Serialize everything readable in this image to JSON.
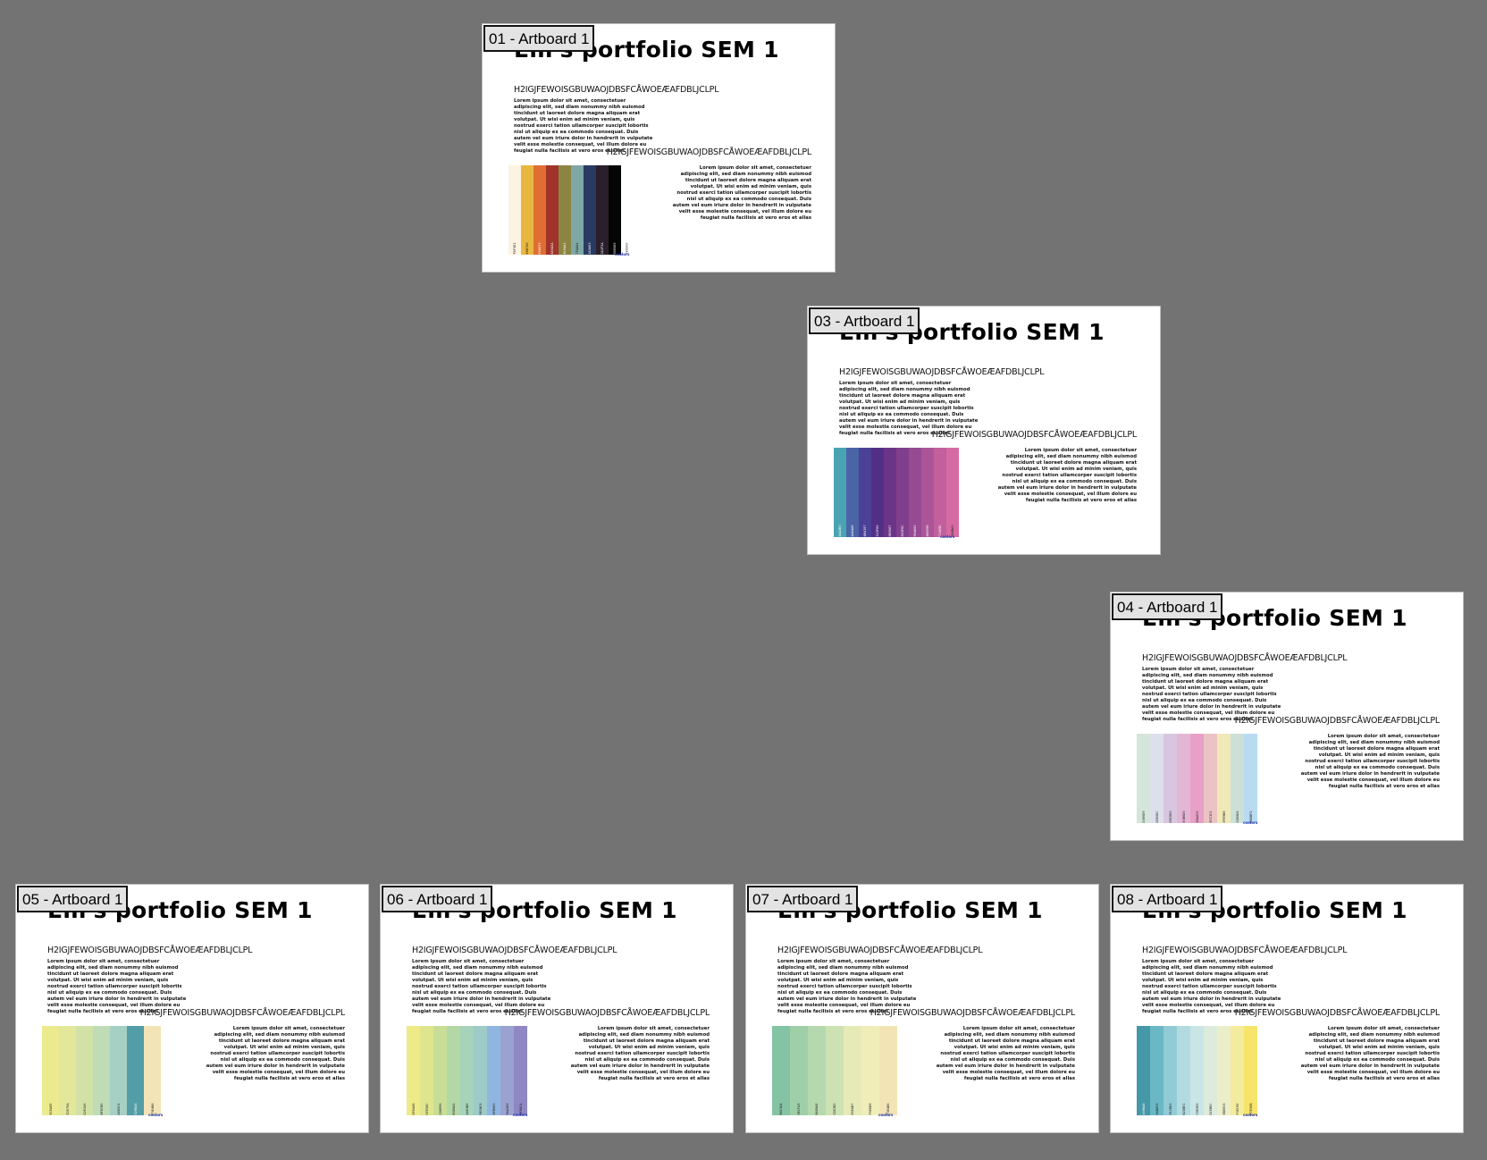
{
  "artboards": [
    {
      "label": "01 - Artboard 1",
      "title": "Em's portfolio SEM 1",
      "heading_a": "H2IGJFEWOISGBUWAOJDBSFCÅWOEÆAFDBLJCLPL",
      "heading_b": "H2IGJFEWOISGBUWAOJDBSFCÅWOEÆAFDBLJCLPL",
      "body_a": "Lorem ipsum dolor sit amet, consectetuer adipiscing elit, sed diam nonummy nibh euismod tincidunt ut laoreet dolore magna aliquam erat volutpat. Ut wisi enim ad minim veniam, quis nostrud exerci tation ullamcorper suscipit lobortis nisl ut aliquip ex ea commodo consequat. Duis autem vel eum iriure dolor in hendrerit in vulputate velit esse molestie consequat, vel illum dolore eu feugiat nulla facilisis at vero eros et allas",
      "body_b": "Lorem ipsum dolor sit amet, consectetuer adipiscing elit, sed diam nonummy nibh euismod tincidunt ut laoreet dolore magna aliquam erat volutpat. Ut wisi enim ad minim veniam, quis nostrud exerci tation ullamcorper suscipit lobortis nisl ut aliquip ex ea commodo consequat. Duis autem vel eum iriure dolor in hendrerit in vulputate velit esse molestie consequat, vel illum dolore eu feugiat nulla facilisis at vero eros et allas",
      "footer_right": "coolors",
      "swatches": [
        {
          "color": "#fdf3e2",
          "code": "FDF3E2"
        },
        {
          "color": "#e8b740",
          "code": "E8B740"
        },
        {
          "color": "#e06e33",
          "code": "E06E33"
        },
        {
          "color": "#a0342a",
          "code": "A0342A"
        },
        {
          "color": "#8c8443",
          "code": "8C8443"
        },
        {
          "color": "#7fa8a4",
          "code": "7FA8A4"
        },
        {
          "color": "#2a3a63",
          "code": "2A3A63"
        },
        {
          "color": "#2a1f2a",
          "code": "2A1F2A"
        },
        {
          "color": "#050505",
          "code": "050505"
        },
        {
          "color": "#ffffff",
          "code": "FFFFFF"
        }
      ]
    },
    {
      "label": "03 - Artboard 1",
      "title": "Em's portfolio SEM 1",
      "heading_a": "H2IGJFEWOISGBUWAOJDBSFCÅWOEÆAFDBLJCLPL",
      "heading_b": "H2IGJFEWOISGBUWAOJDBSFCÅWOEÆAFDBLJCLPL",
      "body_a": "Lorem ipsum dolor sit amet, consectetuer adipiscing elit, sed diam nonummy nibh euismod tincidunt ut laoreet dolore magna aliquam erat volutpat. Ut wisi enim ad minim veniam, quis nostrud exerci tation ullamcorper suscipit lobortis nisl ut aliquip ex ea commodo consequat. Duis autem vel eum iriure dolor in hendrerit in vulputate velit esse molestie consequat, vel illum dolore eu feugiat nulla facilisis at vero eros et allas",
      "body_b": "Lorem ipsum dolor sit amet, consectetuer adipiscing elit, sed diam nonummy nibh euismod tincidunt ut laoreet dolore magna aliquam erat volutpat. Ut wisi enim ad minim veniam, quis nostrud exerci tation ullamcorper suscipit lobortis nisl ut aliquip ex ea commodo consequat. Duis autem vel eum iriure dolor in hendrerit in vulputate velit esse molestie consequat, vel illum dolore eu feugiat nulla facilisis at vero eros et allas",
      "footer_right": "coolors",
      "swatches": [
        {
          "color": "#4aa3b3",
          "code": "4AA3B3"
        },
        {
          "color": "#4a64a6",
          "code": "4A64A6"
        },
        {
          "color": "#4b4197",
          "code": "4B4197"
        },
        {
          "color": "#522f86",
          "code": "522F86"
        },
        {
          "color": "#6b3587",
          "code": "6B3587"
        },
        {
          "color": "#803f8c",
          "code": "803F8C"
        },
        {
          "color": "#964a92",
          "code": "964A92"
        },
        {
          "color": "#ab5598",
          "code": "AB5598"
        },
        {
          "color": "#c1609d",
          "code": "C1609D"
        },
        {
          "color": "#d66ba3",
          "code": "D66BA3"
        }
      ]
    },
    {
      "label": "04 - Artboard 1",
      "title": "Em's portfolio SEM 1",
      "heading_a": "H2IGJFEWOISGBUWAOJDBSFCÅWOEÆAFDBLJCLPL",
      "heading_b": "H2IGJFEWOISGBUWAOJDBSFCÅWOEÆAFDBLJCLPL",
      "body_a": "Lorem ipsum dolor sit amet, consectetuer adipiscing elit, sed diam nonummy nibh euismod tincidunt ut laoreet dolore magna aliquam erat volutpat. Ut wisi enim ad minim veniam, quis nostrud exerci tation ullamcorper suscipit lobortis nisl ut aliquip ex ea commodo consequat. Duis autem vel eum iriure dolor in hendrerit in vulputate velit esse molestie consequat, vel illum dolore eu feugiat nulla facilisis at vero eros et allas",
      "body_b": "Lorem ipsum dolor sit amet, consectetuer adipiscing elit, sed diam nonummy nibh euismod tincidunt ut laoreet dolore magna aliquam erat volutpat. Ut wisi enim ad minim veniam, quis nostrud exerci tation ullamcorper suscipit lobortis nisl ut aliquip ex ea commodo consequat. Duis autem vel eum iriure dolor in hendrerit in vulputate velit esse molestie consequat, vel illum dolore eu feugiat nulla facilisis at vero eros et allas",
      "footer_right": "coolors",
      "swatches": [
        {
          "color": "#d3e6d9",
          "code": "D3E6D9"
        },
        {
          "color": "#dde0ec",
          "code": "DDE0EC"
        },
        {
          "color": "#d8c6e0",
          "code": "D8C6E0"
        },
        {
          "color": "#e3b6d6",
          "code": "E3B6D6"
        },
        {
          "color": "#e8a0c6",
          "code": "E8A0C6"
        },
        {
          "color": "#ecc3c5",
          "code": "ECC3C5"
        },
        {
          "color": "#efe9b8",
          "code": "EFE9B8"
        },
        {
          "color": "#cde0d8",
          "code": "CDE0D8"
        },
        {
          "color": "#b8dbf2",
          "code": "B8DBF2"
        }
      ]
    },
    {
      "label": "05 - Artboard 1",
      "title": "Em's portfolio SEM 1",
      "heading_a": "H2IGJFEWOISGBUWAOJDBSFCÅWOEÆAFDBLJCLPL",
      "heading_b": "H2IGJFEWOISGBUWAOJDBSFCÅWOEÆAFDBLJCLPL",
      "body_a": "Lorem ipsum dolor sit amet, consectetuer adipiscing elit, sed diam nonummy nibh euismod tincidunt ut laoreet dolore magna aliquam erat volutpat. Ut wisi enim ad minim veniam, quis nostrud exerci tation ullamcorper suscipit lobortis nisl ut aliquip ex ea commodo consequat. Duis autem vel eum iriure dolor in hendrerit in vulputate velit esse molestie consequat, vel illum dolore eu feugiat nulla facilisis at vero eros et allas",
      "body_b": "Lorem ipsum dolor sit amet, consectetuer adipiscing elit, sed diam nonummy nibh euismod tincidunt ut laoreet dolore magna aliquam erat volutpat. Ut wisi enim ad minim veniam, quis nostrud exerci tation ullamcorper suscipit lobortis nisl ut aliquip ex ea commodo consequat. Duis autem vel eum iriure dolor in hendrerit in vulputate velit esse molestie consequat, vel illum dolore eu feugiat nulla facilisis at vero eros et allas",
      "footer_right": "coolors",
      "swatches": [
        {
          "color": "#ecea8e",
          "code": "ECEA8E"
        },
        {
          "color": "#e2e79a",
          "code": "E2E79A"
        },
        {
          "color": "#d2e2a6",
          "code": "D2E2A6"
        },
        {
          "color": "#bfdcb6",
          "code": "BFDCB6"
        },
        {
          "color": "#a6d0c4",
          "code": "A6D0C4"
        },
        {
          "color": "#529da6",
          "code": "529DA6"
        },
        {
          "color": "#f3e4b8",
          "code": "F3E4B8"
        }
      ]
    },
    {
      "label": "06 - Artboard 1",
      "title": "Em's portfolio SEM 1",
      "heading_a": "H2IGJFEWOISGBUWAOJDBSFCÅWOEÆAFDBLJCLPL",
      "heading_b": "H2IGJFEWOISGBUWAOJDBSFCÅWOEÆAFDBLJCLPL",
      "body_a": "Lorem ipsum dolor sit amet, consectetuer adipiscing elit, sed diam nonummy nibh euismod tincidunt ut laoreet dolore magna aliquam erat volutpat. Ut wisi enim ad minim veniam, quis nostrud exerci tation ullamcorper suscipit lobortis nisl ut aliquip ex ea commodo consequat. Duis autem vel eum iriure dolor in hendrerit in vulputate velit esse molestie consequat, vel illum dolore eu feugiat nulla facilisis at vero eros et allas",
      "body_b": "Lorem ipsum dolor sit amet, consectetuer adipiscing elit, sed diam nonummy nibh euismod tincidunt ut laoreet dolore magna aliquam erat volutpat. Ut wisi enim ad minim veniam, quis nostrud exerci tation ullamcorper suscipit lobortis nisl ut aliquip ex ea commodo consequat. Duis autem vel eum iriure dolor in hendrerit in vulputate velit esse molestie consequat, vel illum dolore eu feugiat nulla facilisis at vero eros et allas",
      "footer_right": "coolors",
      "swatches": [
        {
          "color": "#efea88",
          "code": "EFEA88"
        },
        {
          "color": "#dfe58c",
          "code": "DFE58C"
        },
        {
          "color": "#c8de96",
          "code": "C8DE96"
        },
        {
          "color": "#b3d8a5",
          "code": "B3D8A5"
        },
        {
          "color": "#a6d3b9",
          "code": "A6D3B9"
        },
        {
          "color": "#9ecbc8",
          "code": "9ECBC8"
        },
        {
          "color": "#8fb6e0",
          "code": "8FB6E0"
        },
        {
          "color": "#9aa2d0",
          "code": "9AA2D0"
        },
        {
          "color": "#8f86c4",
          "code": "8F86C4"
        }
      ]
    },
    {
      "label": "07 - Artboard 1",
      "title": "Em's portfolio SEM 1",
      "heading_a": "H2IGJFEWOISGBUWAOJDBSFCÅWOEÆAFDBLJCLPL",
      "heading_b": "H2IGJFEWOISGBUWAOJDBSFCÅWOEÆAFDBLJCLPL",
      "body_a": "Lorem ipsum dolor sit amet, consectetuer adipiscing elit, sed diam nonummy nibh euismod tincidunt ut laoreet dolore magna aliquam erat volutpat. Ut wisi enim ad minim veniam, quis nostrud exerci tation ullamcorper suscipit lobortis nisl ut aliquip ex ea commodo consequat. Duis autem vel eum iriure dolor in hendrerit in vulputate velit esse molestie consequat, vel illum dolore eu feugiat nulla facilisis at vero eros et allas",
      "body_b": "Lorem ipsum dolor sit amet, consectetuer adipiscing elit, sed diam nonummy nibh euismod tincidunt ut laoreet dolore magna aliquam erat volutpat. Ut wisi enim ad minim veniam, quis nostrud exerci tation ullamcorper suscipit lobortis nisl ut aliquip ex ea commodo consequat. Duis autem vel eum iriure dolor in hendrerit in vulputate velit esse molestie consequat, vel illum dolore eu feugiat nulla facilisis at vero eros et allas",
      "footer_right": "coolors",
      "swatches": [
        {
          "color": "#84c3a4",
          "code": "84C3A4"
        },
        {
          "color": "#9ecfa9",
          "code": "9ECFA9"
        },
        {
          "color": "#b6d8ae",
          "code": "B6D8AE"
        },
        {
          "color": "#cde2b2",
          "code": "CDE2B2"
        },
        {
          "color": "#e6eab7",
          "code": "E6EAB7"
        },
        {
          "color": "#f0edb9",
          "code": "F0EDB9"
        },
        {
          "color": "#f3e4b6",
          "code": "F3E4B6"
        }
      ]
    },
    {
      "label": "08 - Artboard 1",
      "title": "Em's portfolio SEM 1",
      "heading_a": "H2IGJFEWOISGBUWAOJDBSFCÅWOEÆAFDBLJCLPL",
      "heading_b": "H2IGJFEWOISGBUWAOJDBSFCÅWOEÆAFDBLJCLPL",
      "body_a": "Lorem ipsum dolor sit amet, consectetuer adipiscing elit, sed diam nonummy nibh euismod tincidunt ut laoreet dolore magna aliquam erat volutpat. Ut wisi enim ad minim veniam, quis nostrud exerci tation ullamcorper suscipit lobortis nisl ut aliquip ex ea commodo consequat. Duis autem vel eum iriure dolor in hendrerit in vulputate velit esse molestie consequat, vel illum dolore eu feugiat nulla facilisis at vero eros et allas",
      "body_b": "Lorem ipsum dolor sit amet, consectetuer adipiscing elit, sed diam nonummy nibh euismod tincidunt ut laoreet dolore magna aliquam erat volutpat. Ut wisi enim ad minim veniam, quis nostrud exerci tation ullamcorper suscipit lobortis nisl ut aliquip ex ea commodo consequat. Duis autem vel eum iriure dolor in hendrerit in vulputate velit esse molestie consequat, vel illum dolore eu feugiat nulla facilisis at vero eros et allas",
      "footer_right": "coolors",
      "swatches": [
        {
          "color": "#4598a8",
          "code": "4598A8"
        },
        {
          "color": "#6ab8c6",
          "code": "6AB8C6"
        },
        {
          "color": "#91cbd6",
          "code": "91CBD6"
        },
        {
          "color": "#b2dbe1",
          "code": "B2DBE1"
        },
        {
          "color": "#c9e5e6",
          "code": "C9E5E6"
        },
        {
          "color": "#dcebdc",
          "code": "DCEBDC"
        },
        {
          "color": "#ebeec8",
          "code": "EBEEC8"
        },
        {
          "color": "#f3ec9e",
          "code": "F3EC9E"
        },
        {
          "color": "#f7e56b",
          "code": "F7E56B"
        }
      ]
    }
  ]
}
